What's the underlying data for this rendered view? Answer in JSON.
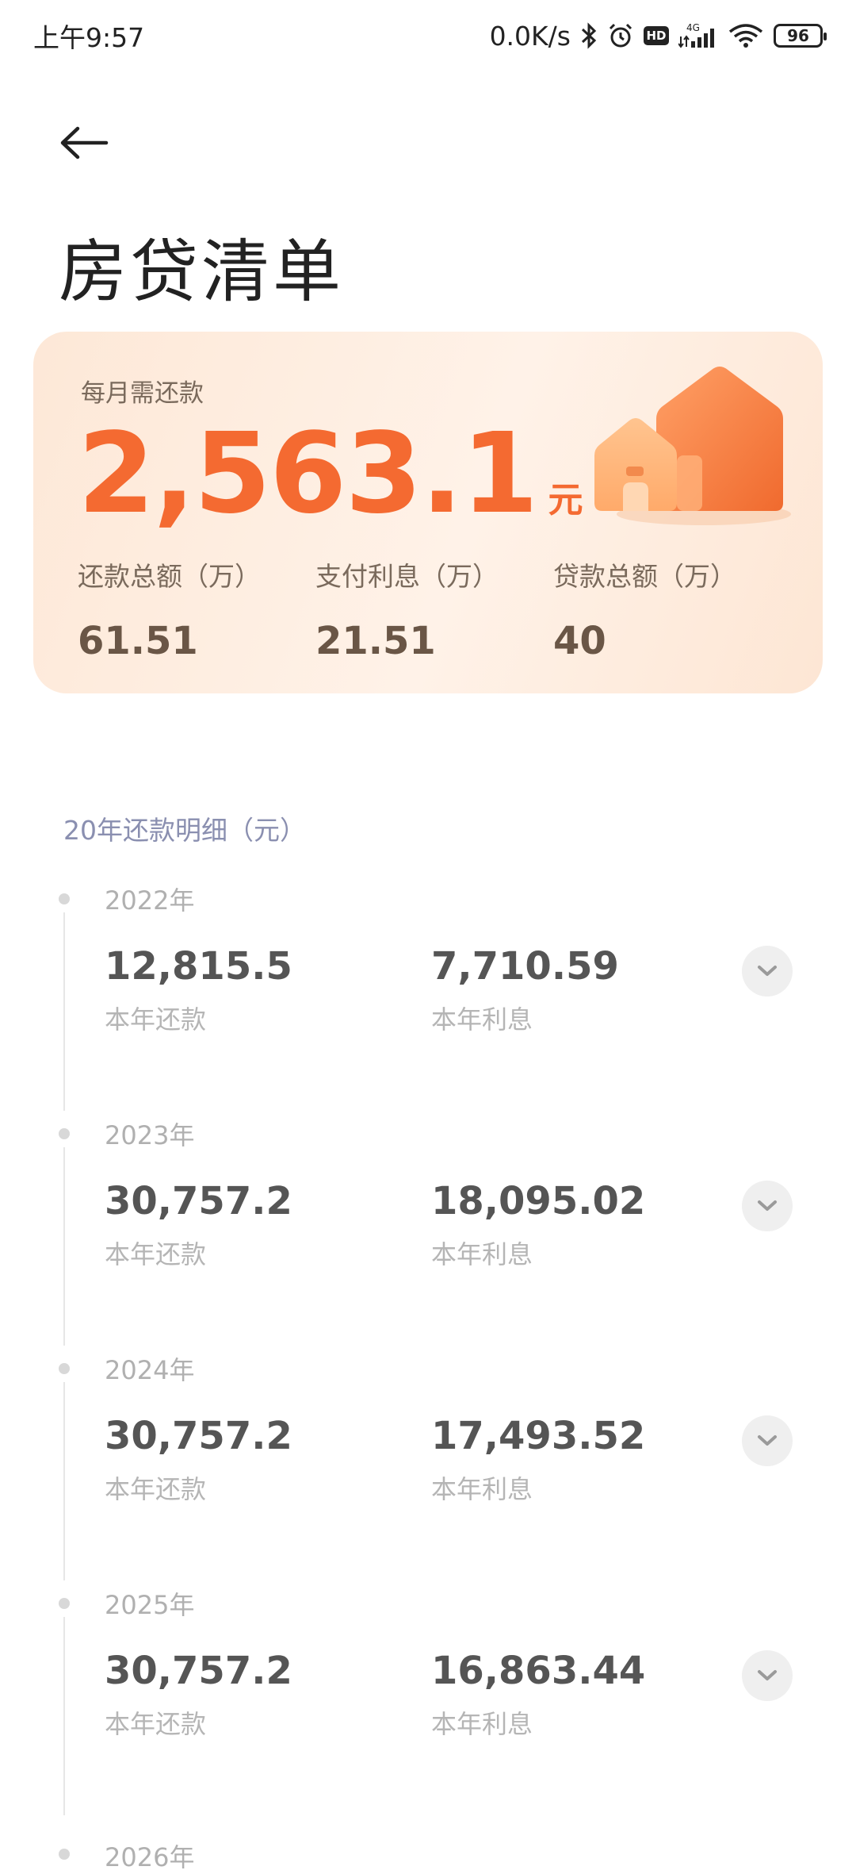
{
  "status_bar": {
    "time": "上午9:57",
    "network_speed": "0.0K/s",
    "signal_type": "4G",
    "battery": "96",
    "icons": [
      "bluetooth-icon",
      "alarm-icon",
      "hd-icon",
      "signal-icon",
      "wifi-icon",
      "battery-icon"
    ]
  },
  "header": {
    "title": "房贷清单"
  },
  "summary": {
    "monthly_label": "每月需还款",
    "monthly_amount": "2,563.1",
    "monthly_unit": "元",
    "stats": [
      {
        "label": "还款总额（万）",
        "value": "61.51"
      },
      {
        "label": "支付利息（万）",
        "value": "21.51"
      },
      {
        "label": "贷款总额（万）",
        "value": "40"
      }
    ]
  },
  "details": {
    "title": "20年还款明细（元）",
    "payment_label": "本年还款",
    "interest_label": "本年利息",
    "years": [
      {
        "year": "2022年",
        "payment": "12,815.5",
        "interest": "7,710.59"
      },
      {
        "year": "2023年",
        "payment": "30,757.2",
        "interest": "18,095.02"
      },
      {
        "year": "2024年",
        "payment": "30,757.2",
        "interest": "17,493.52"
      },
      {
        "year": "2025年",
        "payment": "30,757.2",
        "interest": "16,863.44"
      }
    ],
    "next_year_partial": "2026年"
  },
  "colors": {
    "accent": "#f46a31",
    "card_bg": "#fde8d7",
    "section_title": "#8a8fb0"
  }
}
